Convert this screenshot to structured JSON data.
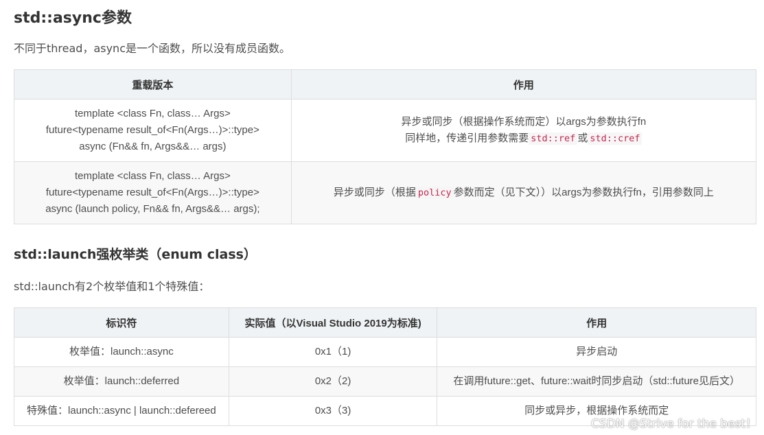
{
  "section1": {
    "title": "std::async参数",
    "intro": "不同于thread，async是一个函数，所以没有成员函数。",
    "table": {
      "headers": [
        "重载版本",
        "作用"
      ],
      "rows": [
        {
          "overload": [
            "template <class Fn, class… Args>",
            "future<typename result_of<Fn(Args…)>::type>",
            "async (Fn&& fn, Args&&… args)"
          ],
          "effect_line1": "异步或同步（根据操作系统而定）以args为参数执行fn",
          "effect_line2_prefix": "同样地，传递引用参数需要",
          "code1": "std::ref",
          "effect_line2_mid": "或",
          "code2": "std::cref"
        },
        {
          "overload": [
            "template <class Fn, class… Args>",
            "future<typename result_of<Fn(Args…)>::type>",
            "async (launch policy, Fn&& fn, Args&&… args);"
          ],
          "effect_prefix": "异步或同步（根据",
          "code": "policy",
          "effect_suffix": "参数而定（见下文））以args为参数执行fn，引用参数同上"
        }
      ]
    }
  },
  "section2": {
    "title": "std::launch强枚举类（enum class）",
    "intro": "std::launch有2个枚举值和1个特殊值：",
    "table": {
      "headers": [
        "标识符",
        "实际值（以Visual Studio 2019为标准)",
        "作用"
      ],
      "rows": [
        [
          "枚举值：launch::async",
          "0x1（1)",
          "异步启动"
        ],
        [
          "枚举值：launch::deferred",
          "0x2（2)",
          "在调用future::get、future::wait时同步启动（std::future见后文）"
        ],
        [
          "特殊值：launch::async | launch::defereed",
          "0x3（3)",
          "同步或异步，根据操作系统而定"
        ]
      ]
    }
  },
  "watermark": "CSDN @Strive for the best！"
}
